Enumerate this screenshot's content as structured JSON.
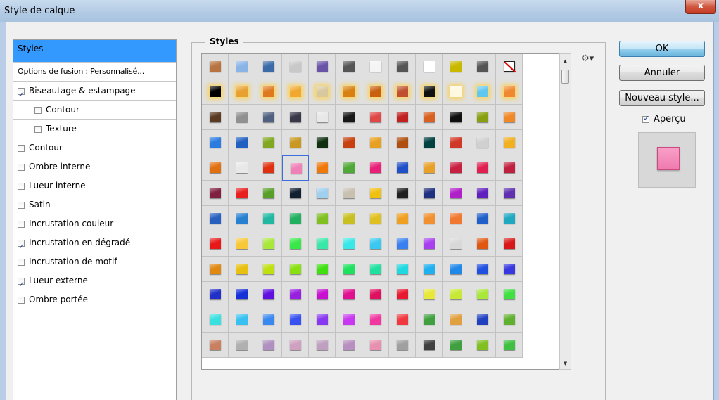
{
  "window": {
    "title": "Style de calque",
    "close_label": "x"
  },
  "left_panel": {
    "header": "Styles",
    "blend_options": "Options de fusion : Personnalisé...",
    "items": [
      {
        "label": "Biseautage & estampage",
        "checked": true,
        "sub": false
      },
      {
        "label": "Contour",
        "checked": false,
        "sub": true
      },
      {
        "label": "Texture",
        "checked": false,
        "sub": true
      },
      {
        "label": "Contour",
        "checked": false,
        "sub": false
      },
      {
        "label": "Ombre interne",
        "checked": false,
        "sub": false
      },
      {
        "label": "Lueur interne",
        "checked": false,
        "sub": false
      },
      {
        "label": "Satin",
        "checked": false,
        "sub": false
      },
      {
        "label": "Incrustation couleur",
        "checked": false,
        "sub": false
      },
      {
        "label": "Incrustation en dégradé",
        "checked": true,
        "sub": false
      },
      {
        "label": "Incrustation de motif",
        "checked": false,
        "sub": false
      },
      {
        "label": "Lueur externe",
        "checked": true,
        "sub": false
      },
      {
        "label": "Ombre portée",
        "checked": false,
        "sub": false
      }
    ]
  },
  "styles_panel": {
    "title": "Styles",
    "selected": [
      4,
      3
    ],
    "rows": [
      [
        "#b87440",
        "#8ab4e6",
        "#3a6aa8",
        "#c8c8c8",
        "#6a54a8",
        "#555555",
        "#f4f4f4",
        "#555555",
        "#ffffff",
        "#c8b800",
        "#555555",
        "none"
      ],
      [
        "#000000",
        "#e8a030",
        "#e07820",
        "#f0a830",
        "#d8c8a0",
        "#d88010",
        "#c86010",
        "#c05030",
        "#101010",
        "#fff8e0",
        "#60c8f0",
        "#f08830"
      ],
      [
        "#5a3a20",
        "#909090",
        "#506080",
        "#383848",
        "#e8e8e8",
        "#181818",
        "#e04848",
        "#c02020",
        "#d86020",
        "#101010",
        "#88a010",
        "#f08828"
      ],
      [
        "#2a7ce0",
        "#2060c0",
        "#80a820",
        "#c89820",
        "#103010",
        "#c84010",
        "#e8a020",
        "#b05010",
        "#004040",
        "#d03828",
        "#d0d0d0",
        "#f0b020"
      ],
      [
        "#e07010",
        "#e8e8e8",
        "#e03010",
        "#f080b8",
        "#f07808",
        "#50a838",
        "#e82078",
        "#2050c8",
        "#e8a028",
        "#c82040",
        "#e02050",
        "#c02040"
      ],
      [
        "#802040",
        "#e82020",
        "#58a028",
        "#102030",
        "#a0d0f0",
        "#c8c0b0",
        "#f0c010",
        "#202020",
        "#203080",
        "#b020c8",
        "#6020c0",
        "#6030b0"
      ],
      [
        "#2860c0",
        "#2880d0",
        "#20b8a0",
        "#20b060",
        "#80c020",
        "#c8c020",
        "#e0c020",
        "#f0a020",
        "#f09030",
        "#f07830",
        "#2060c8",
        "#20a8c0"
      ],
      [
        "#e81818",
        "#f8c838",
        "#a8e838",
        "#38e848",
        "#38e8a8",
        "#38e8e8",
        "#38c8f0",
        "#3880f0",
        "#a840f0",
        "#d8d8d8",
        "#e05810",
        "#d81818"
      ],
      [
        "#e08810",
        "#e8c010",
        "#c0e010",
        "#88e010",
        "#40e010",
        "#20e060",
        "#20e0a0",
        "#20d8e0",
        "#20b0f0",
        "#2088e8",
        "#2050e0",
        "#3838e0"
      ],
      [
        "#2030c8",
        "#1830d8",
        "#6010e0",
        "#9820e0",
        "#c810d0",
        "#e01090",
        "#e01060",
        "#e81830",
        "#e8e838",
        "#c8e838",
        "#a8e838",
        "#40e040"
      ],
      [
        "#38e0e0",
        "#38c0f0",
        "#3888f0",
        "#3850f0",
        "#8838f0",
        "#c838f0",
        "#f038a0",
        "#f03840",
        "#40a040",
        "#e0a040",
        "#2040c0",
        "#60b030"
      ],
      [
        "#c88060",
        "#b0b0b0",
        "#b090c0",
        "#d0a0c0",
        "#c0a0c0",
        "#b890c0",
        "#e890b0",
        "#a0a0a0",
        "#404040",
        "#40a040",
        "#80c020",
        "#40c040"
      ]
    ]
  },
  "buttons": {
    "ok": "OK",
    "cancel": "Annuler",
    "new_style": "Nouveau style..."
  },
  "preview": {
    "label": "Aperçu",
    "checked": true,
    "swatch_color": "#f07aae"
  },
  "icons": {
    "menu": "gear-icon",
    "up": "scroll-up-icon",
    "down": "scroll-down-icon"
  }
}
